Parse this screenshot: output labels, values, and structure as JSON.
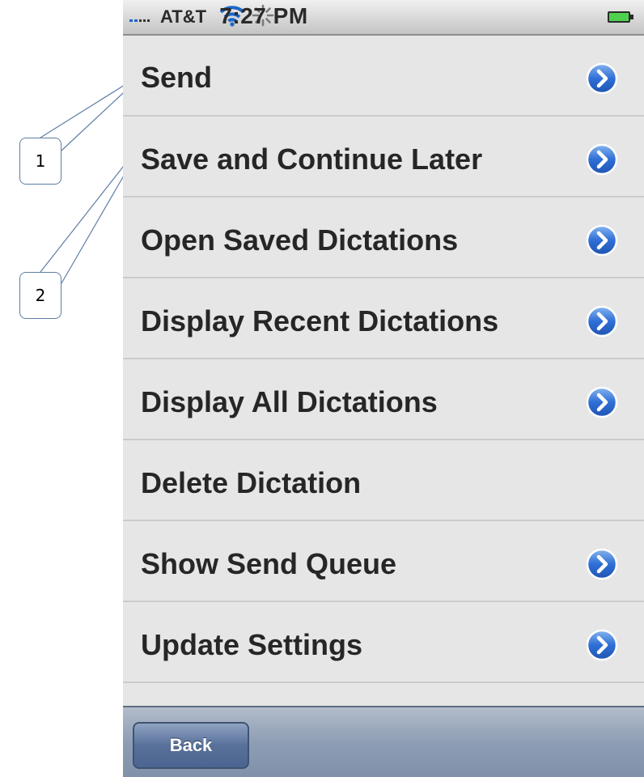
{
  "callouts": [
    "1",
    "2"
  ],
  "status_bar": {
    "carrier": "AT&T",
    "time": "7:27 PM",
    "wifi_icon": "wifi-icon",
    "activity_icon": "activity-spinner-icon",
    "battery_icon": "battery-icon",
    "signal_color": "#1b66c9"
  },
  "menu": {
    "items": [
      {
        "label": "Send",
        "has_disclosure": true
      },
      {
        "label": "Save and Continue Later",
        "has_disclosure": true
      },
      {
        "label": "Open Saved Dictations",
        "has_disclosure": true
      },
      {
        "label": "Display Recent Dictations",
        "has_disclosure": true
      },
      {
        "label": "Display All Dictations",
        "has_disclosure": true
      },
      {
        "label": "Delete Dictation",
        "has_disclosure": false
      },
      {
        "label": "Show Send Queue",
        "has_disclosure": true
      },
      {
        "label": "Update Settings",
        "has_disclosure": true
      }
    ],
    "disclosure_icon": "chevron-right-circle-icon",
    "disclosure_color": "#2f6fd6"
  },
  "toolbar": {
    "back_label": "Back"
  }
}
